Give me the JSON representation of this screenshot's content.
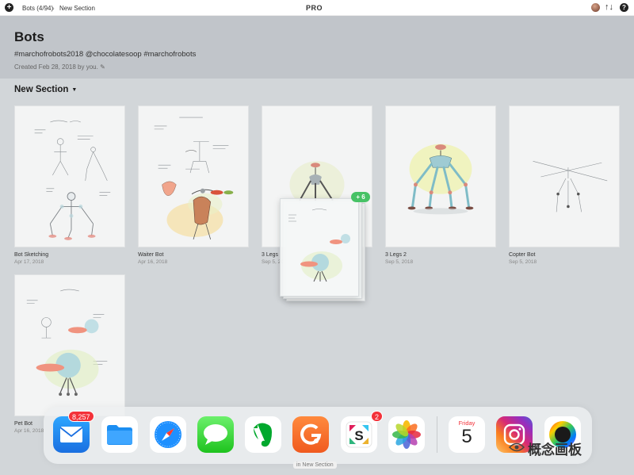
{
  "topbar": {
    "breadcrumb_notebook": "Bots (4/94)",
    "breadcrumb_separator": "›",
    "breadcrumb_section": "New Section",
    "center_badge": "PRO",
    "add_glyph": "+",
    "sort_glyph": "↑↓",
    "help_glyph": "?"
  },
  "notebook": {
    "title": "Bots",
    "tags": "#marchofrobots2018 @chocolatesoop #marchofrobots",
    "created": "Created Feb 28, 2018 by you. ✎"
  },
  "section": {
    "title": "New Section",
    "caret": "▼"
  },
  "cards": [
    {
      "name": "Bot Sketching",
      "date": "Apr 17, 2018"
    },
    {
      "name": "Waiter Bot",
      "date": "Apr 16, 2018"
    },
    {
      "name": "3 Legs",
      "date": "Sep 5, 2018"
    },
    {
      "name": "3 Legs 2",
      "date": "Sep 5, 2018"
    },
    {
      "name": "Copter Bot",
      "date": "Sep 5, 2018"
    },
    {
      "name": "Pet Bot",
      "date": "Apr 16, 2018"
    }
  ],
  "drag": {
    "count_badge": "+ 6"
  },
  "dock": {
    "apps": [
      {
        "name": "Mail",
        "icon": "mail-icon",
        "badge": "8,257"
      },
      {
        "name": "Files",
        "icon": "files-icon"
      },
      {
        "name": "Safari",
        "icon": "safari-icon"
      },
      {
        "name": "Messages",
        "icon": "messages-icon"
      },
      {
        "name": "Evernote",
        "icon": "evernote-icon"
      },
      {
        "name": "Grammarly",
        "icon": "grammarly-icon"
      },
      {
        "name": "Slack",
        "icon": "slack-icon",
        "badge": "2"
      },
      {
        "name": "Photos",
        "icon": "photos-icon"
      },
      {
        "name": "Calendar",
        "icon": "calendar-icon",
        "day": "Friday",
        "date": "5"
      },
      {
        "name": "Instagram",
        "icon": "instagram-icon"
      },
      {
        "name": "Color Picker",
        "icon": "color-wheel-icon"
      }
    ],
    "caption": "in New Section"
  },
  "watermark": {
    "text": "概念画板"
  },
  "colors": {
    "header_bg": "#c1c5ca",
    "page_bg": "#d2d6d9",
    "badge_green": "#47c266",
    "badge_red": "#f3323a"
  }
}
